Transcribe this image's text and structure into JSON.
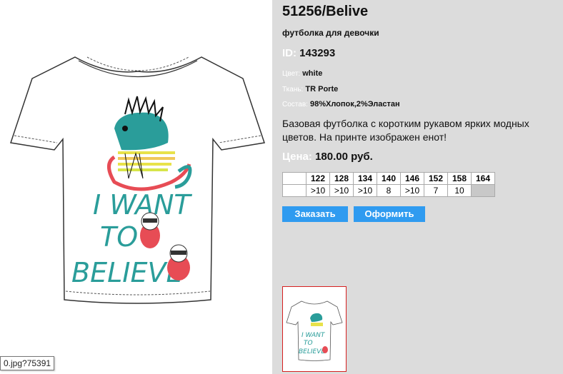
{
  "product": {
    "title": "51256/Belive",
    "subtitle": "футболка для девочки",
    "id_label": "ID:",
    "id_value": "143293",
    "color_label": "Цвет:",
    "color_value": "white",
    "fabric_label": "Ткань:",
    "fabric_value": "TR Porte",
    "composition_label": "Состав:",
    "composition_value": "98%Хлопок,2%Эластан",
    "description": "Базовая футболка с коротким рукавом ярких модных цветов. На принте изображен енот!",
    "price_label": "Цена:",
    "price_value": "180.00 руб."
  },
  "sizes": {
    "headers": [
      "122",
      "128",
      "134",
      "140",
      "146",
      "152",
      "158",
      "164"
    ],
    "stock": [
      ">10",
      ">10",
      ">10",
      "8",
      ">10",
      "7",
      "10",
      ""
    ]
  },
  "buttons": {
    "order": "Заказать",
    "checkout": "Оформить"
  },
  "image": {
    "tooltip": "0.jpg?75391",
    "print_text": "I WANT TO BELIEVE",
    "print_word_1": "I WANT",
    "print_word_2": "TO",
    "print_word_3": "BELIEVE"
  },
  "colors": {
    "panel_bg": "#dcdcdc",
    "button_bg": "#2f9bf0",
    "thumb_border": "#d62020",
    "print_teal": "#2a9d9a"
  }
}
